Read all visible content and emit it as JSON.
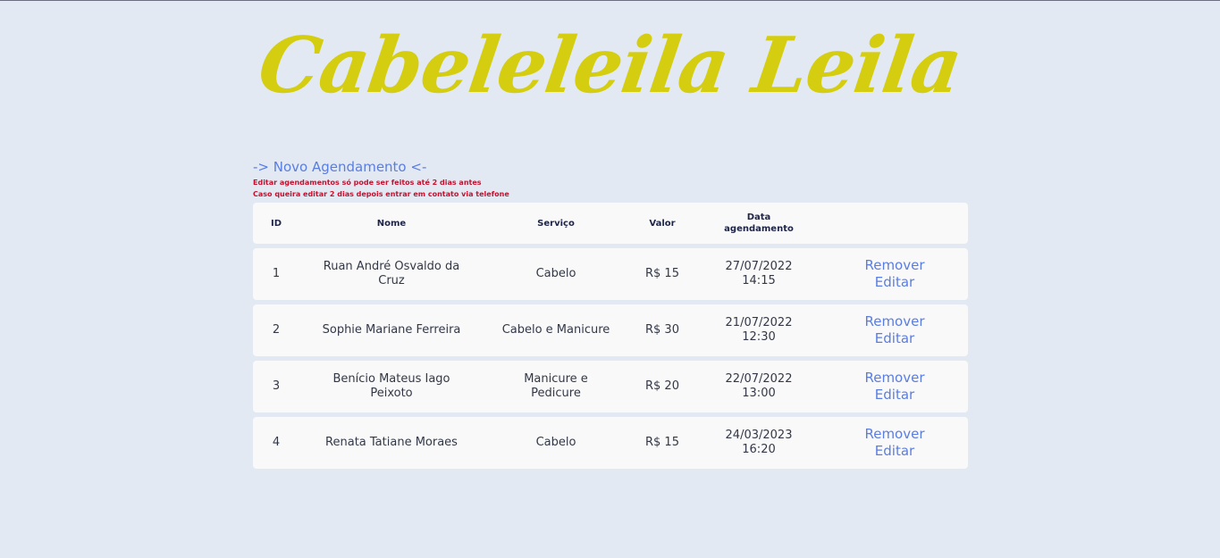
{
  "brand": {
    "title": "Cabeleleila Leila",
    "color": "#d4cd10"
  },
  "new_appointment_link": "-> Novo Agendamento <-",
  "notices": [
    "Editar agendamentos só pode ser feitos até 2 dias antes",
    "Caso queira editar 2 dias depois entrar em contato via telefone"
  ],
  "table": {
    "headers": {
      "id": "ID",
      "nome": "Nome",
      "servico": "Serviço",
      "valor": "Valor",
      "data": "Data agendamento"
    },
    "rows": [
      {
        "id": "1",
        "nome": "Ruan André Osvaldo da Cruz",
        "servico": "Cabelo",
        "valor": "R$ 15",
        "data": "27/07/2022",
        "hora": "14:15",
        "remover": "Remover",
        "editar": "Editar"
      },
      {
        "id": "2",
        "nome": "Sophie Mariane Ferreira",
        "servico": "Cabelo e Manicure",
        "valor": "R$ 30",
        "data": "21/07/2022",
        "hora": "12:30",
        "remover": "Remover",
        "editar": "Editar"
      },
      {
        "id": "3",
        "nome": "Benício Mateus Iago Peixoto",
        "servico": "Manicure e Pedicure",
        "valor": "R$ 20",
        "data": "22/07/2022",
        "hora": "13:00",
        "remover": "Remover",
        "editar": "Editar"
      },
      {
        "id": "4",
        "nome": "Renata Tatiane Moraes",
        "servico": "Cabelo",
        "valor": "R$ 15",
        "data": "24/03/2023",
        "hora": "16:20",
        "remover": "Remover",
        "editar": "Editar"
      }
    ]
  },
  "colors": {
    "background": "#e2e9f3",
    "link": "#5a7de0",
    "warning": "#c8102e",
    "row": "#f9f9fa"
  }
}
